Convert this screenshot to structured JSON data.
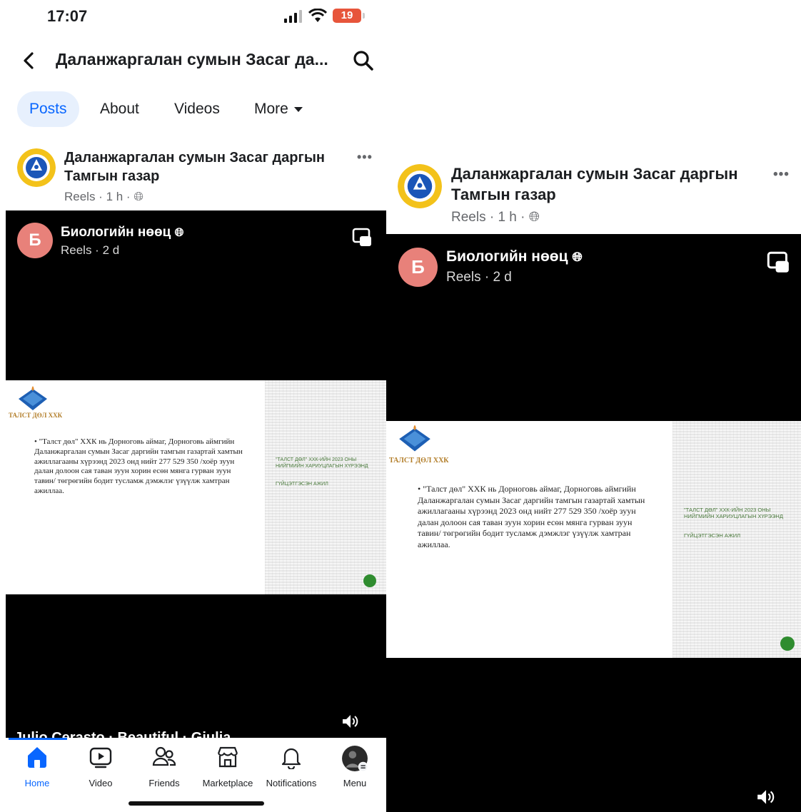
{
  "status": {
    "time": "17:07",
    "battery": "19"
  },
  "header": {
    "title": "Даланжаргалан сумын Засаг да..."
  },
  "tabs": [
    {
      "label": "Posts",
      "active": true
    },
    {
      "label": "About"
    },
    {
      "label": "Videos"
    },
    {
      "label": "More"
    }
  ],
  "post": {
    "page_name_line1": "Даланжаргалан сумын Засаг даргын",
    "page_name_line2": "Тамгын газар",
    "meta": "Reels · 1 h · ",
    "reel": {
      "avatar_letter": "Б",
      "name": "Биологийн нөөц",
      "meta": "Reels · 2 d",
      "caption": "Julio Cerasto · Beautiful · Giulia",
      "slide": {
        "brand": "ТАЛСТ ДӨЛ ХХК",
        "text": "• \"Талст дөл\" ХХК нь Дорноговь аймаг, Дорноговь аймгийн Даланжаргалан сумын Засаг даргийн тамгын газартай хамтын ажиллагааны хүрээнд 2023 онд нийт 277 529 350 /хоёр зуун далан долоон сая таван зуун хорин есөн мянга гурван зуун тавин/ төгрөгийн бодит тусламж дэмжлэг үзүүлж хамтран ажиллаа.",
        "side_title": "\"ТАЛСТ ДӨЛ\" ХХК-ИЙН 2023 ОНЫ НИЙГМИЙН ХАРИУЦЛАГЫН ХҮРЭЭНД",
        "side_sub": "ГҮЙЦЭТГЭСЭН АЖИЛ"
      }
    }
  },
  "nav": [
    {
      "label": "Home",
      "icon": "home-icon",
      "active": true
    },
    {
      "label": "Video",
      "icon": "video-icon"
    },
    {
      "label": "Friends",
      "icon": "friends-icon"
    },
    {
      "label": "Marketplace",
      "icon": "marketplace-icon"
    },
    {
      "label": "Notifications",
      "icon": "bell-icon"
    },
    {
      "label": "Menu",
      "icon": "menu-avatar-icon"
    }
  ],
  "colors": {
    "accent": "#0866ff",
    "reel_avatar": "#e8817a",
    "battery": "#e7553b"
  }
}
